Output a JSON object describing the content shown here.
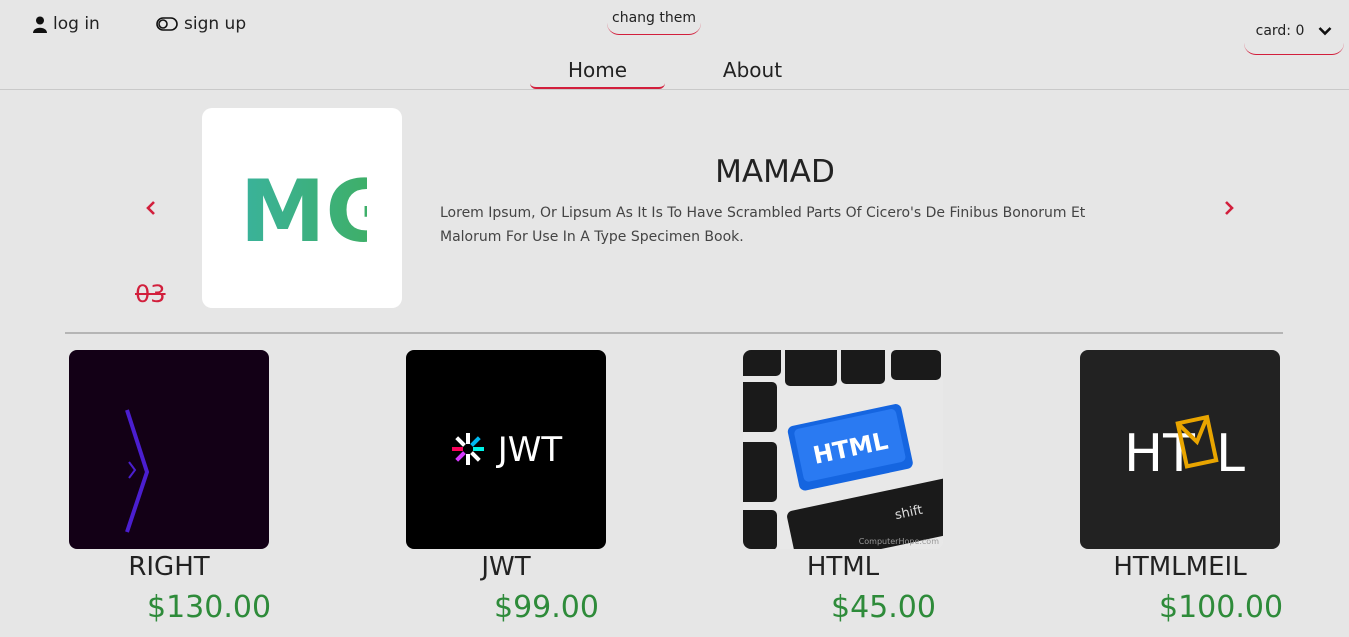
{
  "header": {
    "login_label": "log in",
    "signup_label": "sign up",
    "theme_label": "chang them",
    "cart_label": "card: 0",
    "nav": [
      {
        "label": "Home",
        "active": true
      },
      {
        "label": "About",
        "active": false
      }
    ]
  },
  "slider": {
    "index": "03",
    "title": "MAMAD",
    "description": "Lorem Ipsum, Or Lipsum As It Is To Have Scrambled Parts Of Cicero's De Finibus Bonorum Et Malorum For Use In A Type Specimen Book.",
    "image_text": "IMG"
  },
  "products": [
    {
      "name": "RIGHT",
      "price": "$130.00"
    },
    {
      "name": "JWT",
      "price": "$99.00",
      "image_text": "JWT"
    },
    {
      "name": "HTML",
      "price": "$45.00",
      "image_text": "HTML",
      "image_caption": "ComputerHope.com",
      "key_label": "shift"
    },
    {
      "name": "HTMLMEIL",
      "price": "$100.00",
      "image_text_left": "HT",
      "image_text_right": "L"
    }
  ],
  "colors": {
    "accent": "#d21f3c",
    "price": "#2e8b3a",
    "background": "#e6e6e6"
  }
}
